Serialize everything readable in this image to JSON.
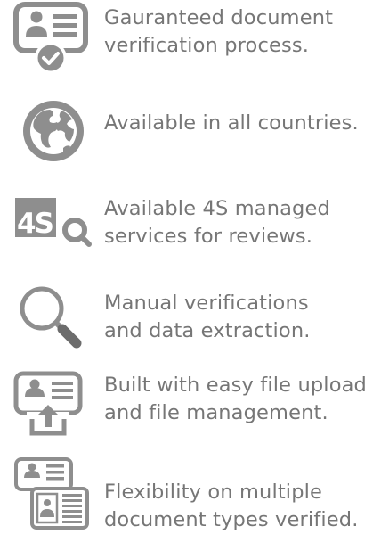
{
  "features": [
    {
      "icon": "verified-document-icon",
      "line1": "Gauranteed document",
      "line2": "verification process."
    },
    {
      "icon": "globe-icon",
      "line1": "Available in all countries.",
      "line2": ""
    },
    {
      "icon": "4s-search-icon",
      "icon_text": "4S",
      "line1": "Available 4S managed",
      "line2": "services for reviews."
    },
    {
      "icon": "magnifier-icon",
      "line1": "Manual verifications",
      "line2": "and data extraction."
    },
    {
      "icon": "file-upload-icon",
      "line1": "Built with easy file upload",
      "line2": "and file management."
    },
    {
      "icon": "multiple-documents-icon",
      "line1": "Flexibility on multiple",
      "line2": "document types verified."
    }
  ],
  "colors": {
    "text": "#767676",
    "icon": "#8e8e8e",
    "icon_dark": "#6c6c6c",
    "background": "#ffffff"
  }
}
